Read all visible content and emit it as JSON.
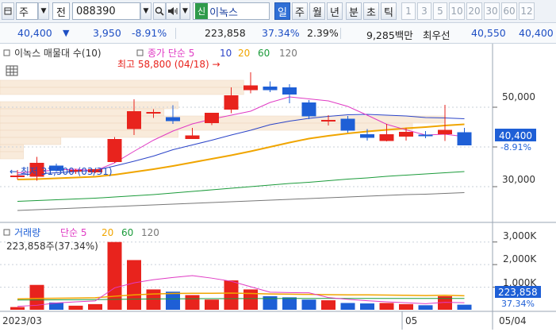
{
  "toolbar": {
    "menu_label": "주",
    "jeon_label": "전",
    "code_value": "088390",
    "stock_name": "이녹스",
    "new_badge": "신",
    "periods_kr": [
      "일",
      "주",
      "월",
      "년",
      "분",
      "초",
      "틱"
    ],
    "active_period": "일",
    "periods_num": [
      "1",
      "3",
      "5",
      "10",
      "20",
      "30",
      "60",
      "12"
    ]
  },
  "info": {
    "price": "40,400",
    "change_arrow": "▼",
    "change": "3,950",
    "change_pct": "-8.91%",
    "volume": "223,858",
    "volume_ratio": "37.34%",
    "turnover": "2.39%",
    "trade_value": "9,285백만",
    "pref_label": "최우선",
    "ask": "40,550",
    "bid": "40,400"
  },
  "price_legend": {
    "title": "이녹스 매물대 수(10)",
    "ma_label": "종가 단순 5",
    "ma_periods": [
      "10",
      "20",
      "60",
      "120"
    ]
  },
  "annotations": {
    "high": "최고 58,800 (04/18) →",
    "low": "← 최저 31,500 (03/31)"
  },
  "price_axis": {
    "ticks": [
      "50,000",
      "40,000",
      "30,000"
    ],
    "last": "40,400",
    "last_pct": "-8.91%"
  },
  "volume_legend": {
    "title": "거래량",
    "ma_label": "단순 5",
    "ma_periods": [
      "20",
      "60",
      "120"
    ],
    "current": "223,858주(37.34%)"
  },
  "volume_axis": {
    "ticks": [
      "3,000K",
      "2,000K",
      "1,000K"
    ],
    "last": "223,858",
    "last_pct": "37.34%"
  },
  "date_axis": {
    "left_label": "2023/03",
    "mid_label": "05",
    "right_label": "05/04"
  },
  "colors": {
    "up": "#e8231d",
    "down": "#1e5fd6",
    "ma5": "#e03bc4",
    "ma10": "#2b44c8",
    "ma20": "#f0a500",
    "ma60": "#1b9b3a",
    "ma120": "#777777",
    "accent": "#2f6fd6"
  },
  "icons": [
    "dropdown-icon",
    "search-icon",
    "speaker-icon",
    "sort-icon",
    "chart-grid-icon"
  ],
  "chart_data": {
    "type": "candlestick",
    "price_range": [
      22000,
      62000
    ],
    "volume_range": [
      0,
      3200000
    ],
    "candles": [
      {
        "o": 32500,
        "h": 34200,
        "l": 31800,
        "c": 32800
      },
      {
        "o": 32500,
        "h": 37500,
        "l": 31500,
        "c": 36000
      },
      {
        "o": 35300,
        "h": 35800,
        "l": 33700,
        "c": 34000
      },
      {
        "o": 33800,
        "h": 34500,
        "l": 33200,
        "c": 34200
      },
      {
        "o": 33600,
        "h": 34500,
        "l": 33400,
        "c": 34400
      },
      {
        "o": 36200,
        "h": 42500,
        "l": 36000,
        "c": 42000
      },
      {
        "o": 44500,
        "h": 52000,
        "l": 43000,
        "c": 49000
      },
      {
        "o": 48700,
        "h": 49500,
        "l": 47300,
        "c": 48800
      },
      {
        "o": 47500,
        "h": 50500,
        "l": 45800,
        "c": 46500
      },
      {
        "o": 42000,
        "h": 44800,
        "l": 42000,
        "c": 42900
      },
      {
        "o": 46000,
        "h": 48500,
        "l": 45500,
        "c": 48600
      },
      {
        "o": 49400,
        "h": 55000,
        "l": 48500,
        "c": 53000
      },
      {
        "o": 54300,
        "h": 58800,
        "l": 53500,
        "c": 55500
      },
      {
        "o": 55200,
        "h": 56500,
        "l": 53800,
        "c": 54300
      },
      {
        "o": 55000,
        "h": 55800,
        "l": 51000,
        "c": 53200
      },
      {
        "o": 51200,
        "h": 51800,
        "l": 47000,
        "c": 47700
      },
      {
        "o": 46800,
        "h": 48000,
        "l": 45400,
        "c": 46800
      },
      {
        "o": 47100,
        "h": 47800,
        "l": 43600,
        "c": 44100
      },
      {
        "o": 43200,
        "h": 44500,
        "l": 41600,
        "c": 42300
      },
      {
        "o": 41500,
        "h": 45800,
        "l": 41400,
        "c": 43200
      },
      {
        "o": 42600,
        "h": 44800,
        "l": 41600,
        "c": 43800
      },
      {
        "o": 43100,
        "h": 44000,
        "l": 42200,
        "c": 43000
      },
      {
        "o": 43200,
        "h": 50600,
        "l": 41500,
        "c": 44300
      },
      {
        "o": 43700,
        "h": 44800,
        "l": 40400,
        "c": 40400
      }
    ],
    "ma5": [
      33500,
      33800,
      34200,
      34400,
      34000,
      36000,
      38900,
      41700,
      44000,
      45800,
      47000,
      48000,
      49000,
      51200,
      52600,
      52100,
      51600,
      50200,
      48000,
      45700,
      44300,
      43000,
      43200,
      42600
    ],
    "ma10": [
      33000,
      33200,
      33500,
      33800,
      34100,
      35200,
      36400,
      37700,
      39300,
      40500,
      41700,
      43000,
      44200,
      45600,
      46500,
      47200,
      47700,
      48100,
      48200,
      48000,
      47800,
      47400,
      47300,
      47100
    ],
    "ma20": [
      31800,
      31900,
      32100,
      32300,
      32500,
      33000,
      33700,
      34400,
      35200,
      36100,
      37000,
      37900,
      38900,
      40000,
      41100,
      42100,
      42800,
      43400,
      43900,
      44300,
      44700,
      45000,
      45400,
      45700
    ],
    "ma60": [
      26300,
      26500,
      26700,
      26900,
      27100,
      27400,
      27700,
      28000,
      28400,
      28800,
      29200,
      29600,
      30000,
      30400,
      30800,
      31100,
      31500,
      31900,
      32200,
      32600,
      32900,
      33200,
      33500,
      33800
    ],
    "ma120": [
      24000,
      24200,
      24400,
      24600,
      24800,
      25000,
      25200,
      25400,
      25600,
      25800,
      26000,
      26200,
      26400,
      26600,
      26800,
      27000,
      27200,
      27400,
      27600,
      27800,
      28000,
      28100,
      28300,
      28500
    ],
    "volume": [
      120000,
      1100000,
      320000,
      180000,
      250000,
      3000000,
      2200000,
      900000,
      800000,
      650000,
      450000,
      1300000,
      900000,
      600000,
      550000,
      450000,
      420000,
      300000,
      280000,
      300000,
      250000,
      200000,
      600000,
      223858
    ],
    "vol_ma5": [
      150000,
      200000,
      300000,
      350000,
      390000,
      970000,
      1190000,
      1330000,
      1430000,
      1510000,
      1400000,
      1260000,
      1020000,
      780000,
      760000,
      750000,
      540000,
      460000,
      400000,
      350000,
      310000,
      270000,
      330000,
      310000
    ],
    "vol_ma20": [
      480000,
      500000,
      510000,
      520000,
      530000,
      600000,
      660000,
      700000,
      720000,
      730000,
      730000,
      740000,
      720000,
      700000,
      690000,
      680000,
      670000,
      660000,
      660000,
      650000,
      640000,
      630000,
      640000,
      620000
    ],
    "vol_ma60": [
      430000,
      435000,
      440000,
      445000,
      450000,
      460000,
      470000,
      480000,
      485000,
      490000,
      492000,
      494000,
      496000,
      498000,
      500000,
      500000,
      500000,
      500000,
      500000,
      500000,
      500000,
      500000,
      500000,
      500000
    ],
    "volume_profile": [
      {
        "low": 55000,
        "high": 56800,
        "level": 0.52
      },
      {
        "low": 53200,
        "high": 55000,
        "level": 0.52
      },
      {
        "low": 49600,
        "high": 51400,
        "level": 0.38
      },
      {
        "low": 47800,
        "high": 49600,
        "level": 0.35
      },
      {
        "low": 46000,
        "high": 47800,
        "level": 0.95
      },
      {
        "low": 44200,
        "high": 46000,
        "level": 0.88
      },
      {
        "low": 42400,
        "high": 44200,
        "level": 0.38
      },
      {
        "low": 40600,
        "high": 42400,
        "level": 0.13
      },
      {
        "low": 38800,
        "high": 40600,
        "level": 0.05
      },
      {
        "low": 37000,
        "high": 38800,
        "level": 0.05
      }
    ]
  }
}
